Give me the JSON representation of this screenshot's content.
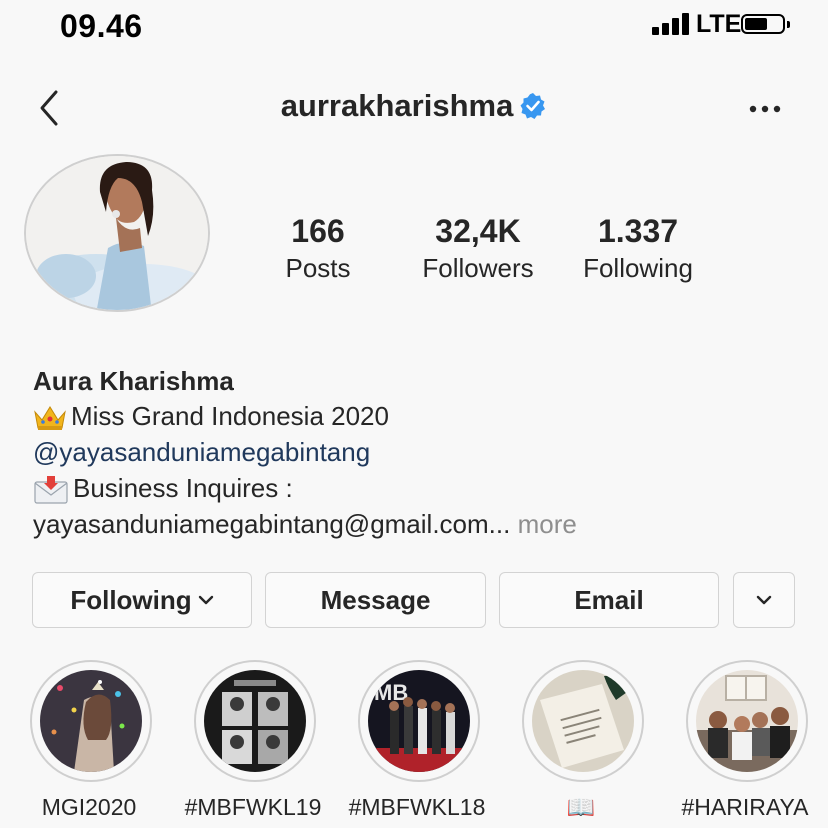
{
  "status_bar": {
    "time": "09.46",
    "network": "LTE",
    "battery_level": 0.6
  },
  "nav": {
    "username": "aurrakharishma",
    "verified": true,
    "back_icon": "chevron-left-icon",
    "menu_icon": "more-horizontal-icon"
  },
  "stats": {
    "posts": {
      "value": "166",
      "label": "Posts"
    },
    "followers": {
      "value": "32,4K",
      "label": "Followers"
    },
    "following": {
      "value": "1.337",
      "label": "Following"
    }
  },
  "bio": {
    "name": "Aura Kharishma",
    "title_emoji": "crown-icon",
    "title": "Miss Grand Indonesia 2020",
    "mention": "@yayasanduniamegabintang",
    "inquiry_emoji": "envelope-icon",
    "inquiry": "Business Inquires :",
    "email": "yayasanduniamegabintang@gmail.com...",
    "more": "more"
  },
  "buttons": {
    "following": "Following",
    "message": "Message",
    "email": "Email"
  },
  "highlights": [
    {
      "label": "MGI2020"
    },
    {
      "label": "#MBFWKL19"
    },
    {
      "label": "#MBFWKL18"
    },
    {
      "label": "📖"
    },
    {
      "label": "#HARIRAYA"
    }
  ],
  "colors": {
    "mention": "#20395c",
    "verified": "#3897f0",
    "muted": "#8e8e8e"
  }
}
